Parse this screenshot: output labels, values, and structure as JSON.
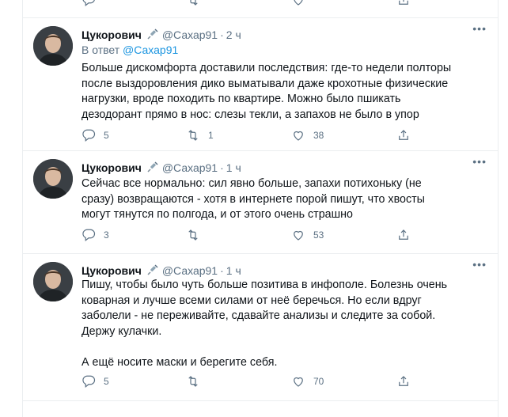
{
  "colors": {
    "text": "#0f1419",
    "secondary": "#5b7083",
    "link": "#1b95e0",
    "border": "#ebeef0"
  },
  "tweets": [
    {
      "name": "Цукорович",
      "badge_icon": "syringe-icon",
      "handle": "@Сахар91",
      "dot": "·",
      "time": "2 ч",
      "reply_prefix": "В ответ",
      "reply_handle": "@Сахар91",
      "paragraphs": [
        "Больше дискомфорта доставили последствия: где-то недели полторы после выздоровления дико выматывали даже крохотные физические нагрузки, вроде походить по квартире. Можно было пшикать дезодорант прямо в нос: слезы текли, а запахов не было в упор"
      ],
      "replies": "5",
      "retweets": "1",
      "likes": "38"
    },
    {
      "name": "Цукорович",
      "badge_icon": "syringe-icon",
      "handle": "@Сахар91",
      "dot": "·",
      "time": "1 ч",
      "paragraphs": [
        "Сейчас все нормально: сил явно больше, запахи потихоньку (не сразу) возвращаются - хотя в интернете порой пишут, что хвосты могут тянутся по полгода, и от этого очень страшно"
      ],
      "replies": "3",
      "retweets": "",
      "likes": "53"
    },
    {
      "name": "Цукорович",
      "badge_icon": "syringe-icon",
      "handle": "@Сахар91",
      "dot": "·",
      "time": "1 ч",
      "paragraphs": [
        "Пишу, чтобы было чуть больше позитива в инфополе. Болезнь очень коварная и лучше всеми силами от неё беречься. Но если вдруг заболели - не переживайте, сдавайте анализы и следите за собой. Держу кулачки.",
        "А ещё носите маски и берегите себя."
      ],
      "replies": "5",
      "retweets": "",
      "likes": "70"
    }
  ],
  "more_glyph": "•••"
}
